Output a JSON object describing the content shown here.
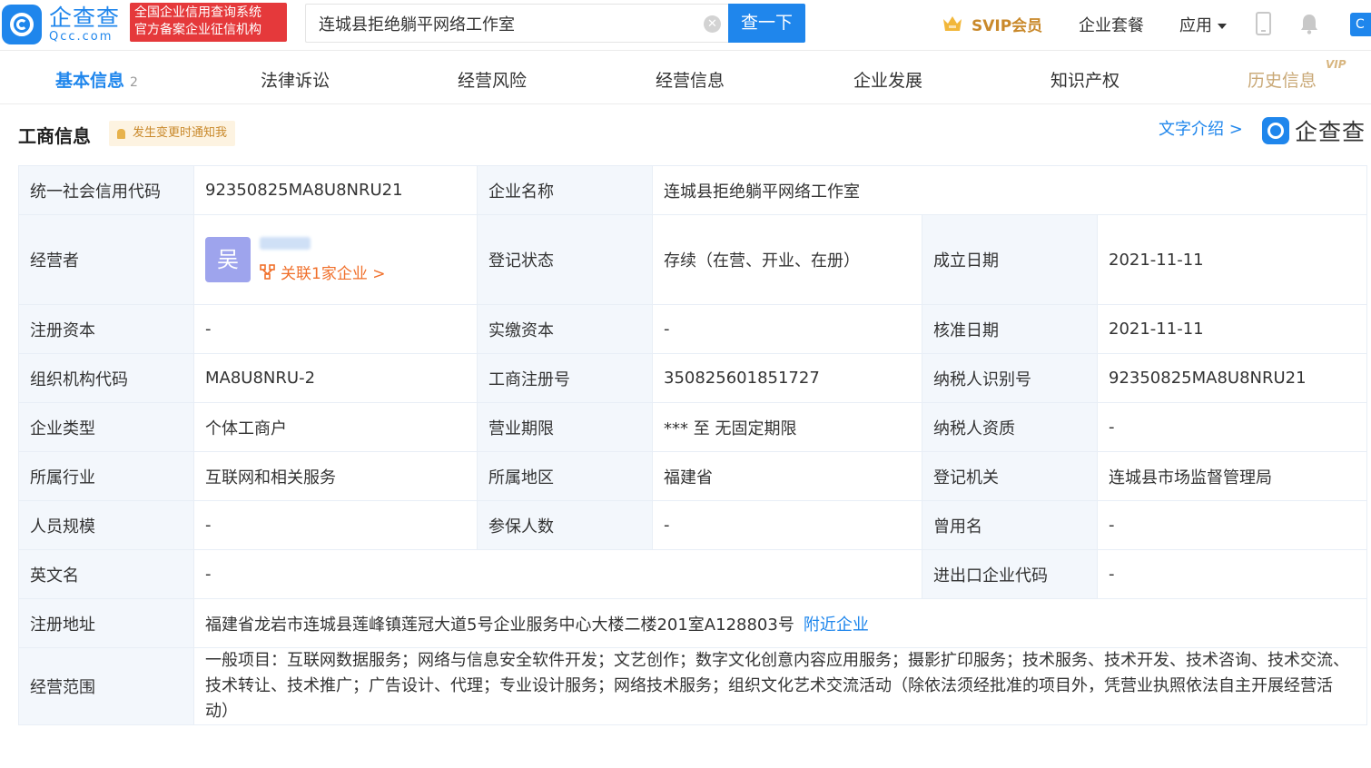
{
  "header": {
    "logo_cn": "企查查",
    "logo_en": "Qcc.com",
    "gov_badge_line1": "全国企业信用查询系统",
    "gov_badge_line2": "官方备案企业征信机构",
    "search_value": "连城县拒绝躺平网络工作室",
    "search_button": "查一下",
    "svip_label": "SVIP会员",
    "nav_package": "企业套餐",
    "nav_app": "应用",
    "edge_button": "C",
    "brand_color": "#1f86ec"
  },
  "tabs": [
    {
      "label": "基本信息",
      "count": "2",
      "active": true
    },
    {
      "label": "法律诉讼"
    },
    {
      "label": "经营风险"
    },
    {
      "label": "经营信息"
    },
    {
      "label": "企业发展"
    },
    {
      "label": "知识产权"
    },
    {
      "label": "历史信息",
      "badge": "VIP"
    }
  ],
  "section": {
    "title": "工商信息",
    "notify_label": "发生变更时通知我",
    "text_intro": "文字介绍 >",
    "brand": "企查查"
  },
  "info": {
    "credit_code_label": "统一社会信用代码",
    "credit_code": "92350825MA8U8NRU21",
    "company_name_label": "企业名称",
    "company_name": "连城县拒绝躺平网络工作室",
    "operator_label": "经营者",
    "operator_avatar": "吴",
    "operator_related": "关联1家企业 >",
    "reg_status_label": "登记状态",
    "reg_status": "存续（在营、开业、在册）",
    "established_label": "成立日期",
    "established": "2021-11-11",
    "reg_capital_label": "注册资本",
    "reg_capital": "-",
    "paid_capital_label": "实缴资本",
    "paid_capital": "-",
    "approved_label": "核准日期",
    "approved": "2021-11-11",
    "org_code_label": "组织机构代码",
    "org_code": "MA8U8NRU-2",
    "biz_reg_no_label": "工商注册号",
    "biz_reg_no": "350825601851727",
    "taxpayer_id_label": "纳税人识别号",
    "taxpayer_id": "92350825MA8U8NRU21",
    "company_type_label": "企业类型",
    "company_type": "个体工商户",
    "biz_term_label": "营业期限",
    "biz_term": "*** 至 无固定期限",
    "taxpayer_qual_label": "纳税人资质",
    "taxpayer_qual": "-",
    "industry_label": "所属行业",
    "industry": "互联网和相关服务",
    "region_label": "所属地区",
    "region": "福建省",
    "reg_authority_label": "登记机关",
    "reg_authority": "连城县市场监督管理局",
    "staff_size_label": "人员规模",
    "staff_size": "-",
    "insured_label": "参保人数",
    "insured": "-",
    "former_name_label": "曾用名",
    "former_name": "-",
    "english_name_label": "英文名",
    "english_name": "-",
    "import_export_label": "进出口企业代码",
    "import_export": "-",
    "address_label": "注册地址",
    "address": "福建省龙岩市连城县莲峰镇莲冠大道5号企业服务中心大楼二楼201室A128803号",
    "nearby_link": "附近企业",
    "scope_label": "经营范围",
    "scope": "一般项目：互联网数据服务；网络与信息安全软件开发；文艺创作；数字文化创意内容应用服务；摄影扩印服务；技术服务、技术开发、技术咨询、技术交流、技术转让、技术推广；广告设计、代理；专业设计服务；网络技术服务；组织文化艺术交流活动（除依法须经批准的项目外，凭营业执照依法自主开展经营活动）"
  }
}
